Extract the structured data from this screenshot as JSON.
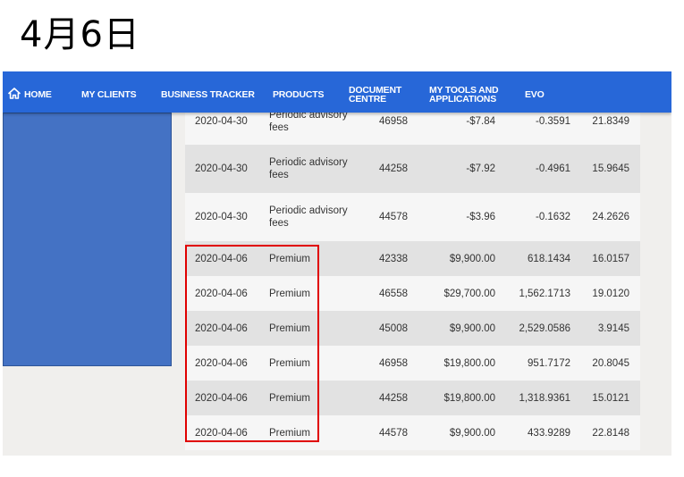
{
  "heading": "4月6日",
  "nav": {
    "home": "HOME",
    "items": [
      "MY CLIENTS",
      "BUSINESS TRACKER",
      "PRODUCTS",
      "DOCUMENT CENTRE",
      "MY TOOLS AND APPLICATIONS",
      "EVO"
    ]
  },
  "rows": [
    {
      "date": "2020-04-30",
      "type": "Periodic advisory fees",
      "account": "46958",
      "amount": "-$7.84",
      "units": "-0.3591",
      "price": "21.8349"
    },
    {
      "date": "2020-04-30",
      "type": "Periodic advisory fees",
      "account": "44258",
      "amount": "-$7.92",
      "units": "-0.4961",
      "price": "15.9645"
    },
    {
      "date": "2020-04-30",
      "type": "Periodic advisory fees",
      "account": "44578",
      "amount": "-$3.96",
      "units": "-0.1632",
      "price": "24.2626"
    },
    {
      "date": "2020-04-06",
      "type": "Premium",
      "account": "42338",
      "amount": "$9,900.00",
      "units": "618.1434",
      "price": "16.0157"
    },
    {
      "date": "2020-04-06",
      "type": "Premium",
      "account": "46558",
      "amount": "$29,700.00",
      "units": "1,562.1713",
      "price": "19.0120"
    },
    {
      "date": "2020-04-06",
      "type": "Premium",
      "account": "45008",
      "amount": "$9,900.00",
      "units": "2,529.0586",
      "price": "3.9145"
    },
    {
      "date": "2020-04-06",
      "type": "Premium",
      "account": "46958",
      "amount": "$19,800.00",
      "units": "951.7172",
      "price": "20.8045"
    },
    {
      "date": "2020-04-06",
      "type": "Premium",
      "account": "44258",
      "amount": "$19,800.00",
      "units": "1,318.9361",
      "price": "15.0121"
    },
    {
      "date": "2020-04-06",
      "type": "Premium",
      "account": "44578",
      "amount": "$9,900.00",
      "units": "433.9289",
      "price": "22.8148"
    }
  ],
  "colors": {
    "navbar": "#2767d8",
    "side_panel": "#4472c4",
    "highlight": "#e00000",
    "row_shade": "#e2e2e2",
    "row_light": "#f6f6f6"
  }
}
